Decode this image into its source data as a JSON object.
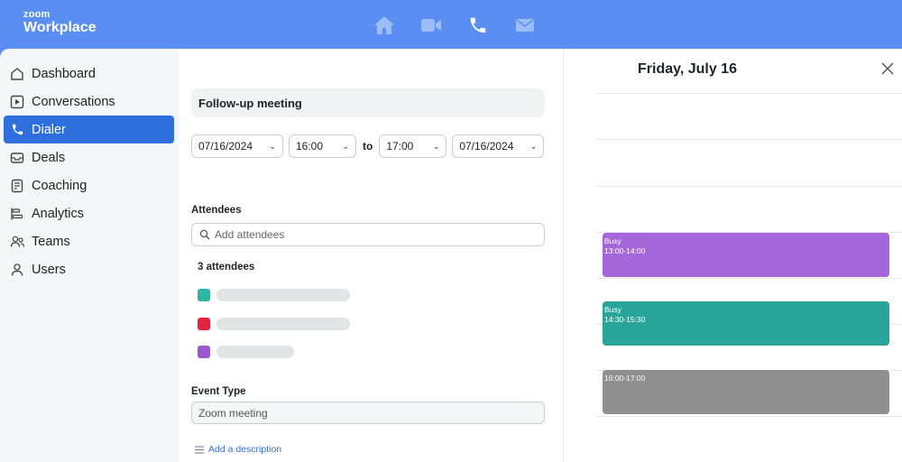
{
  "brand": {
    "line1": "zoom",
    "line2": "Workplace"
  },
  "top_icons": [
    "home-icon",
    "video-icon",
    "phone-icon",
    "mail-icon"
  ],
  "sidebar": {
    "items": [
      {
        "label": "Dashboard",
        "icon": "home-icon",
        "active": false
      },
      {
        "label": "Conversations",
        "icon": "play-square-icon",
        "active": false
      },
      {
        "label": "Dialer",
        "icon": "phone-icon",
        "active": true
      },
      {
        "label": "Deals",
        "icon": "inbox-icon",
        "active": false
      },
      {
        "label": "Coaching",
        "icon": "clipboard-icon",
        "active": false
      },
      {
        "label": "Analytics",
        "icon": "analytics-icon",
        "active": false
      },
      {
        "label": "Teams",
        "icon": "people-icon",
        "active": false
      },
      {
        "label": "Users",
        "icon": "user-icon",
        "active": false
      }
    ]
  },
  "form": {
    "title_value": "Follow-up meeting",
    "start_date": "07/16/2024",
    "start_time": "16:00",
    "to_label": "to",
    "end_time": "17:00",
    "end_date": "07/16/2024",
    "attendees_label": "Attendees",
    "attendees_placeholder": "Add attendees",
    "attendee_count": "3 attendees",
    "attendees": [
      {
        "color": "#2fb5a6"
      },
      {
        "color": "#e0243f"
      },
      {
        "color": "#9b59d0"
      }
    ],
    "event_type_label": "Event Type",
    "event_type_value": "Zoom meeting",
    "add_description": "Add a description"
  },
  "calendar": {
    "title": "Friday, July 16",
    "events": [
      {
        "label": "Busy",
        "time": "13:00-14:00",
        "color": "#a466d8"
      },
      {
        "label": "Busy",
        "time": "14:30-15:30",
        "color": "#2aa599"
      },
      {
        "label": "",
        "time": "16:00-17:00",
        "color": "#8f8f8f"
      }
    ]
  },
  "colors": {
    "accent": "#2f6fdd",
    "topbar": "#5b8ef2"
  }
}
